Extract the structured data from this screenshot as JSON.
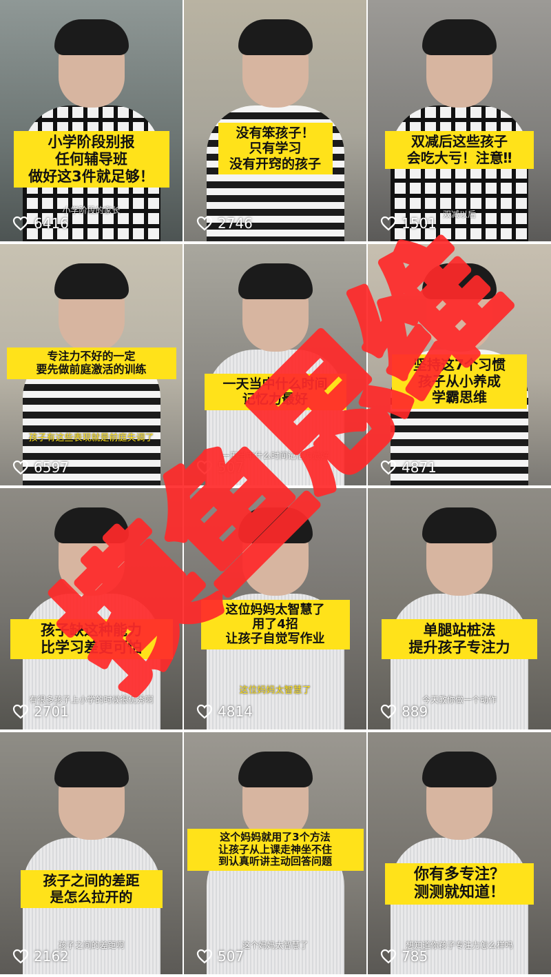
{
  "tiles": [
    {
      "caption": "小学阶段别报\n任何辅导班\n做好这3件就足够！",
      "subtitle": "小学阶段的家长",
      "likes": "6416"
    },
    {
      "caption": "没有笨孩子！\n只有学习\n没有开窍的孩子",
      "subtitle": "",
      "likes": "2746"
    },
    {
      "caption": "双减后这些孩子\n会吃大亏！注意‼",
      "subtitle": "双减以后",
      "likes": "1501"
    },
    {
      "caption": "专注力不好的一定\n要先做前庭激活的训练",
      "subtitle": "孩子有这些表现就是前庭失调了",
      "likes": "6597"
    },
    {
      "caption": "一天当中什么时间\n记忆力最好",
      "subtitle": "一天当中什么时间记忆力最好",
      "likes": "507"
    },
    {
      "caption": "坚持这7个习惯\n孩子从小养成\n学霸思维",
      "subtitle": "",
      "likes": "4871"
    },
    {
      "caption": "孩子缺这种能力\n比学习差更可怕",
      "subtitle": "有很多孩子上小学的时候很优秀啊",
      "likes": "2701"
    },
    {
      "caption": "这位妈妈太智慧了\n用了4招\n让孩子自觉写作业",
      "subtitle": "这位妈妈太智慧了",
      "likes": "4814"
    },
    {
      "caption": "单腿站桩法\n提升孩子专注力",
      "subtitle": "今天教你做一个动作",
      "likes": "889"
    },
    {
      "caption": "孩子之间的差距\n是怎么拉开的",
      "subtitle": "孩子之间的差距啊",
      "likes": "2162"
    },
    {
      "caption": "这个妈妈就用了3个方法\n让孩子从上课走神坐不住\n到认真听讲主动回答问题",
      "subtitle": "这个妈妈太智慧了",
      "likes": "507"
    },
    {
      "caption": "你有多专注？\n测测就知道！",
      "subtitle": "想知道你孩子专注力怎么样吗",
      "likes": "785"
    }
  ],
  "watermark": {
    "text": "摸鱼思维",
    "color": "#ff2a2a"
  },
  "colors": {
    "caption_bg": "#ffe21a",
    "caption_text": "#111111"
  },
  "icons": {
    "like": "heart-outline-icon"
  }
}
